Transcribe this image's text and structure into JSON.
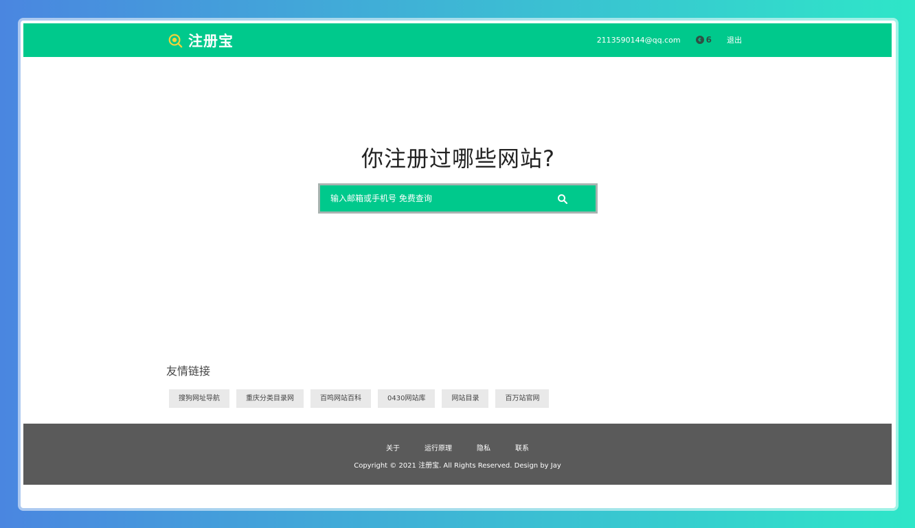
{
  "header": {
    "brand_name": "注册宝",
    "user_email": "2113590144@qq.com",
    "credits": "6",
    "logout_label": "退出"
  },
  "hero": {
    "title": "你注册过哪些网站?",
    "search_placeholder": "输入邮箱或手机号 免费查询"
  },
  "friend_links": {
    "title": "友情链接",
    "items": [
      "搜狗网址导航",
      "重庆分类目录网",
      "百鸣网站百科",
      "0430网站库",
      "网站目录",
      "百万站官网"
    ]
  },
  "footer": {
    "nav": [
      "关于",
      "运行原理",
      "隐私",
      "联系"
    ],
    "copyright": "Copyright © 2021 注册宝. All Rights Reserved. Design by Jay"
  },
  "colors": {
    "accent": "#00c98c",
    "footer_bg": "#5a5a5a",
    "logo_yellow": "#f4d23a"
  }
}
